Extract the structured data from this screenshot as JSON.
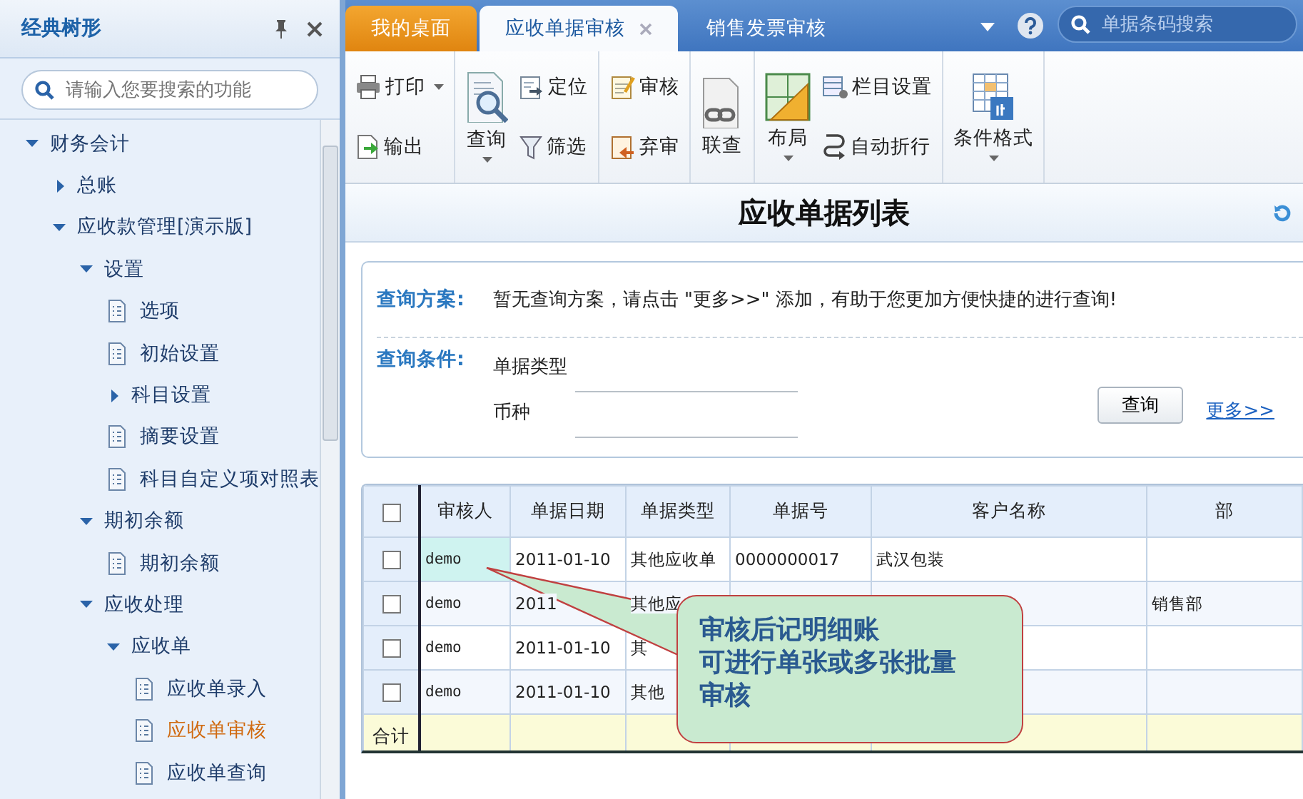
{
  "sidebar": {
    "title": "经典树形",
    "search": {
      "placeholder": "请输入您要搜索的功能"
    },
    "tree": [
      {
        "label": "财务会计",
        "kind": "folder",
        "expanded": true,
        "selected": false,
        "children": [
          {
            "label": "总账",
            "kind": "folder",
            "expanded": false,
            "selected": false
          },
          {
            "label": "应收款管理[演示版]",
            "kind": "folder",
            "expanded": true,
            "selected": false,
            "children": [
              {
                "label": "设置",
                "kind": "folder",
                "expanded": true,
                "selected": false,
                "children": [
                  {
                    "label": "选项",
                    "kind": "leaf",
                    "selected": false
                  },
                  {
                    "label": "初始设置",
                    "kind": "leaf",
                    "selected": false
                  },
                  {
                    "label": "科目设置",
                    "kind": "folder",
                    "expanded": false,
                    "selected": false
                  },
                  {
                    "label": "摘要设置",
                    "kind": "leaf",
                    "selected": false
                  },
                  {
                    "label": "科目自定义项对照表",
                    "kind": "leaf",
                    "selected": false
                  }
                ]
              },
              {
                "label": "期初余额",
                "kind": "folder",
                "expanded": true,
                "selected": false,
                "children": [
                  {
                    "label": "期初余额",
                    "kind": "leaf",
                    "selected": false
                  }
                ]
              },
              {
                "label": "应收处理",
                "kind": "folder",
                "expanded": true,
                "selected": false,
                "children": [
                  {
                    "label": "应收单",
                    "kind": "folder",
                    "expanded": true,
                    "selected": false,
                    "children": [
                      {
                        "label": "应收单录入",
                        "kind": "leaf",
                        "selected": false
                      },
                      {
                        "label": "应收单审核",
                        "kind": "leaf",
                        "selected": true
                      },
                      {
                        "label": "应收单查询",
                        "kind": "leaf",
                        "selected": false
                      }
                    ]
                  }
                ]
              }
            ]
          }
        ]
      }
    ]
  },
  "tabs": [
    {
      "label": "我的桌面",
      "kind": "home",
      "selected": false,
      "closable": false
    },
    {
      "label": "应收单据审核",
      "kind": "doc",
      "selected": true,
      "closable": true
    },
    {
      "label": "销售发票审核",
      "kind": "doc",
      "selected": false,
      "closable": false
    }
  ],
  "barcode_search": {
    "placeholder": "单据条码搜索"
  },
  "toolbar": [
    [
      {
        "label": "打印",
        "kind": "small",
        "dropdown": true
      },
      {
        "label": "输出",
        "kind": "small",
        "dropdown": false
      }
    ],
    [
      {
        "label": "查询",
        "kind": "large",
        "dropdown": true
      },
      {
        "label": "定位",
        "kind": "small",
        "dropdown": false
      },
      {
        "label": "筛选",
        "kind": "small",
        "dropdown": false
      }
    ],
    [
      {
        "label": "审核",
        "kind": "small",
        "dropdown": false
      },
      {
        "label": "弃审",
        "kind": "small",
        "dropdown": false
      }
    ],
    [
      {
        "label": "联查",
        "kind": "large",
        "dropdown": false
      }
    ],
    [
      {
        "label": "布局",
        "kind": "large",
        "dropdown": true
      },
      {
        "label": "栏目设置",
        "kind": "small",
        "dropdown": false
      },
      {
        "label": "自动折行",
        "kind": "small",
        "dropdown": false
      }
    ],
    [
      {
        "label": "条件格式",
        "kind": "large",
        "dropdown": true
      }
    ]
  ],
  "page_title": "应收单据列表",
  "query": {
    "scheme_label": "查询方案:",
    "scheme_text": "暂无查询方案，请点击 \"更多>>\" 添加，有助于您更加方便快捷的进行查询!",
    "condition_label": "查询条件:",
    "fields": [
      {
        "label": "单据类型"
      },
      {
        "label": "币种"
      }
    ],
    "button": "查询",
    "more_link": "更多>>"
  },
  "table": {
    "all_checked": false,
    "columns": [
      "审核人",
      "单据日期",
      "单据类型",
      "单据号",
      "客户名称",
      "部"
    ],
    "rows": [
      {
        "checked": false,
        "current": true,
        "cells": [
          "demo",
          "2011-01-10",
          "其他应收单",
          "0000000017",
          "武汉包装",
          ""
        ]
      },
      {
        "checked": false,
        "current": false,
        "cells": [
          "demo",
          "2011",
          "其他应",
          "",
          "",
          "销售部"
        ]
      },
      {
        "checked": false,
        "current": false,
        "cells": [
          "demo",
          "2011-01-10",
          "其",
          "",
          "",
          ""
        ]
      },
      {
        "checked": false,
        "current": false,
        "cells": [
          "demo",
          "2011-01-10",
          "其他",
          "",
          "",
          ""
        ]
      }
    ],
    "total_label": "合计"
  },
  "callout": {
    "lines": [
      "审核后记明细账",
      "可进行单张或多张批量",
      "审核"
    ]
  }
}
